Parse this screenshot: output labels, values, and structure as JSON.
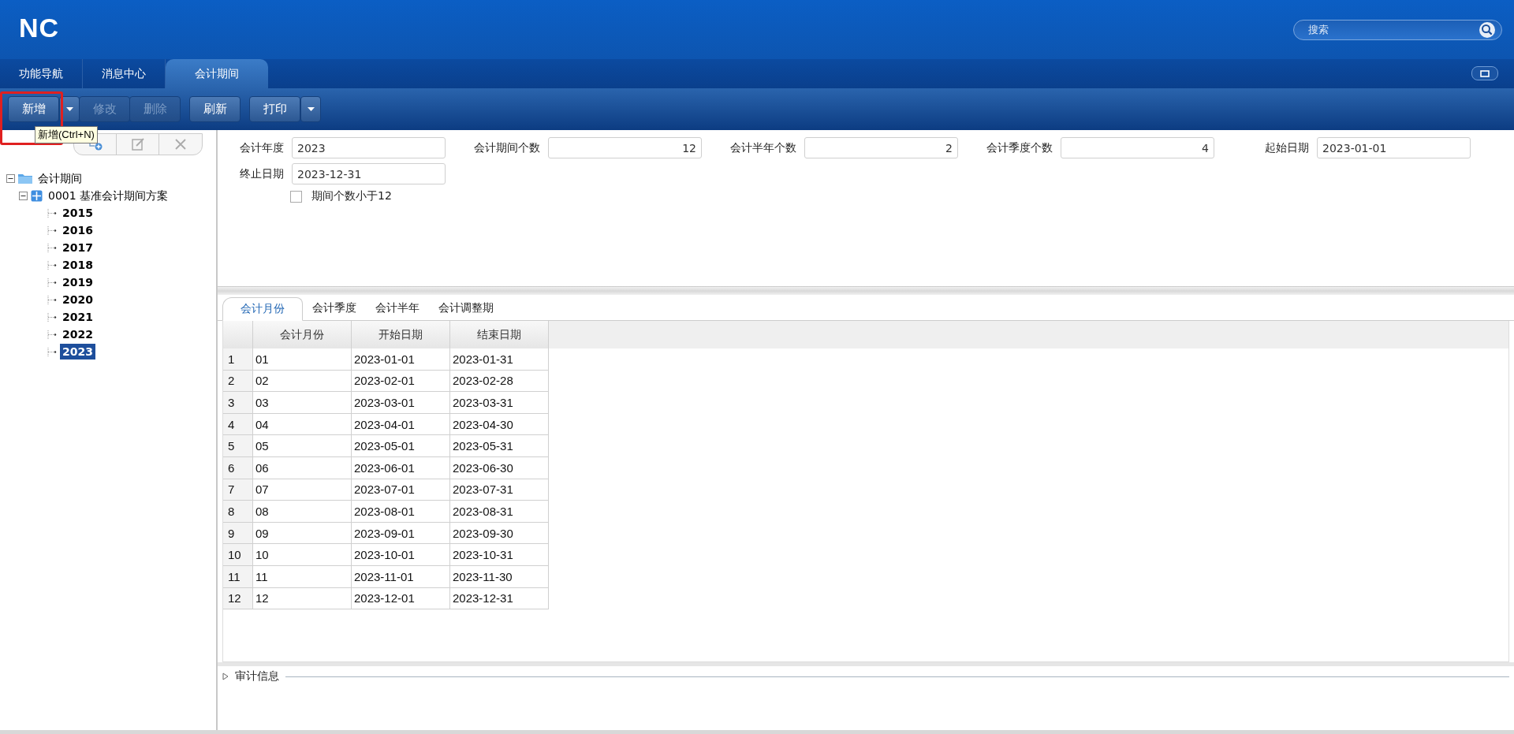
{
  "header": {
    "logo": "NC",
    "search": {
      "placeholder": "搜索"
    }
  },
  "tabs": [
    {
      "label": "功能导航",
      "selected": false
    },
    {
      "label": "消息中心",
      "selected": false
    },
    {
      "label": "会计期间",
      "selected": true
    }
  ],
  "toolbar": [
    {
      "label": "新增",
      "disabled": false,
      "dropdown": true,
      "highlighted": true
    },
    {
      "label": "修改",
      "disabled": true,
      "dropdown": false,
      "highlighted": false
    },
    {
      "label": "删除",
      "disabled": true,
      "dropdown": false,
      "highlighted": false
    },
    {
      "label": "刷新",
      "disabled": false,
      "dropdown": false,
      "highlighted": false
    },
    {
      "label": "打印",
      "disabled": false,
      "dropdown": true,
      "highlighted": false
    }
  ],
  "tooltip": "新增(Ctrl+N)",
  "tree": [
    {
      "label": "会计期间",
      "kind": "folder",
      "expanded": true,
      "selected": false,
      "children": [
        {
          "label": "0001 基准会计期间方案",
          "kind": "scheme",
          "expanded": true,
          "selected": false,
          "children": [
            {
              "label": "2015",
              "kind": "leaf",
              "selected": false
            },
            {
              "label": "2016",
              "kind": "leaf",
              "selected": false
            },
            {
              "label": "2017",
              "kind": "leaf",
              "selected": false
            },
            {
              "label": "2018",
              "kind": "leaf",
              "selected": false
            },
            {
              "label": "2019",
              "kind": "leaf",
              "selected": false
            },
            {
              "label": "2020",
              "kind": "leaf",
              "selected": false
            },
            {
              "label": "2021",
              "kind": "leaf",
              "selected": false
            },
            {
              "label": "2022",
              "kind": "leaf",
              "selected": false
            },
            {
              "label": "2023",
              "kind": "leaf",
              "selected": true
            }
          ]
        }
      ]
    }
  ],
  "form": {
    "fields": [
      {
        "label": "会计年度",
        "value": "2023",
        "kind": "text"
      },
      {
        "label": "会计期间个数",
        "value": "12",
        "kind": "number"
      },
      {
        "label": "会计半年个数",
        "value": "2",
        "kind": "number"
      },
      {
        "label": "会计季度个数",
        "value": "4",
        "kind": "number"
      },
      {
        "label": "起始日期",
        "value": "2023-01-01",
        "kind": "text"
      },
      {
        "label": "终止日期",
        "value": "2023-12-31",
        "kind": "text"
      }
    ],
    "checkbox": {
      "label": "期间个数小于12",
      "checked": false
    }
  },
  "detail_tabs": [
    {
      "label": "会计月份",
      "selected": true
    },
    {
      "label": "会计季度",
      "selected": false
    },
    {
      "label": "会计半年",
      "selected": false
    },
    {
      "label": "会计调整期",
      "selected": false
    }
  ],
  "table": {
    "columns": [
      "",
      "会计月份",
      "开始日期",
      "结束日期"
    ],
    "rows": [
      [
        "1",
        "01",
        "2023-01-01",
        "2023-01-31"
      ],
      [
        "2",
        "02",
        "2023-02-01",
        "2023-02-28"
      ],
      [
        "3",
        "03",
        "2023-03-01",
        "2023-03-31"
      ],
      [
        "4",
        "04",
        "2023-04-01",
        "2023-04-30"
      ],
      [
        "5",
        "05",
        "2023-05-01",
        "2023-05-31"
      ],
      [
        "6",
        "06",
        "2023-06-01",
        "2023-06-30"
      ],
      [
        "7",
        "07",
        "2023-07-01",
        "2023-07-31"
      ],
      [
        "8",
        "08",
        "2023-08-01",
        "2023-08-31"
      ],
      [
        "9",
        "09",
        "2023-09-01",
        "2023-09-30"
      ],
      [
        "10",
        "10",
        "2023-10-01",
        "2023-10-31"
      ],
      [
        "11",
        "11",
        "2023-11-01",
        "2023-11-30"
      ],
      [
        "12",
        "12",
        "2023-12-01",
        "2023-12-31"
      ]
    ]
  },
  "audit": {
    "label": "审计信息",
    "expanded": false
  }
}
